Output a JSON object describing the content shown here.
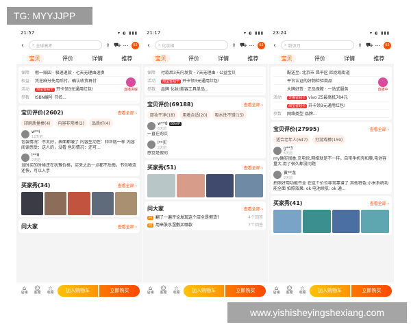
{
  "tg_label": "TG: MYYJJPP",
  "watermark": "www.yishisheyingshexiang.com",
  "icons": {
    "back": "back-icon",
    "share": "share-icon",
    "cart": "cart-icon",
    "more": "more-icon",
    "shop": "shop-icon",
    "service": "service-icon",
    "fav": "star-icon",
    "search": "search-icon"
  },
  "common": {
    "tabs": [
      "宝贝",
      "评价",
      "详情",
      "推荐"
    ],
    "badge": "65",
    "bottom": {
      "shop": "店铺",
      "service": "客服",
      "fav": "收藏",
      "cart": "加入购物车",
      "buy": "立即购买"
    },
    "more": "查看全部"
  },
  "screens": [
    {
      "time": "21:57",
      "status_right": "▾ ◐ ▮▮▮",
      "search": "全球高考",
      "params": [
        {
          "k": "保障",
          "v": "假一赔四 · 极速退款 · 七天无理由退换"
        },
        {
          "k": "权益",
          "v": "凭芝麻分先用后付，确认收货再付"
        },
        {
          "k": "活动",
          "tag": "淘宝省钱卡",
          "v": "开卡领3元通用红包!"
        },
        {
          "k": "参数",
          "v": "ISBN编号 书名..."
        }
      ],
      "live": "直播讲解",
      "review_title": "宝贝评价(2602)",
      "chips": [
        "印刷质量棒(4)",
        "内容非常棒(2)",
        "品质好(4)"
      ],
      "reviews": [
        {
          "user": "w**i",
          "date": "12天前",
          "text": "包装情况：不太好，表面都皱了 内容生动性：和正版一样 内容阅读感受：送人的，没看 色彩情况：还可…"
        },
        {
          "user": "l**8",
          "date": "2天前",
          "text": "当时买的时候还在犹豫价格，买来之后一点都不后悔，书包物流还快，可以入手"
        }
      ],
      "show_title": "买家秀(34)",
      "photos": [
        "#3b3b46",
        "#8b6d5a",
        "#c2543f",
        "#5f6a7a",
        "#a89070"
      ],
      "qa_title": "问大家"
    },
    {
      "time": "21:17",
      "status_right": "▾ ◐ ▮▮▮",
      "search": "化妆棉",
      "params": [
        {
          "k": "保障",
          "v": "付款后3天内发货 · 7天无理由 · 公益宝贝"
        },
        {
          "k": "活动",
          "tag": "淘宝省钱卡",
          "v": "开卡领3元通用红包!"
        },
        {
          "k": "参数",
          "v": "品牌 化妆/美容工具单品..."
        }
      ],
      "review_title": "宝贝评价(69188)",
      "chips": [
        "卸妆干净(18)",
        "用着合适(20)",
        "吸水性不错(15)"
      ],
      "reviews": [
        {
          "user": "w**8",
          "vip": "88VIP",
          "date": "6天前",
          "text": "一直在购买"
        },
        {
          "user": "l**实",
          "date": "2天前",
          "text": "感觉是假的"
        }
      ],
      "show_title": "买家秀(51)",
      "photos": [
        "#b9c6c8",
        "#d89c8a",
        "#3f4a6c",
        "#6e8aa5"
      ],
      "qa_title": "问大家",
      "qa": [
        {
          "q": "翻了一遍评论发现这个店全是假货?",
          "n": "4个回答"
        },
        {
          "q": "用来肤水湿敷买哪款",
          "n": "7个回答"
        }
      ]
    },
    {
      "time": "23:24",
      "status_right": "▾ ◐ ▮▮▮",
      "search": "剃须刀",
      "params": [
        {
          "k": "",
          "v": "配送至: 北京市 昌平区 回龙观街道"
        },
        {
          "k": "",
          "v": "平台认证的好物检验商品"
        },
        {
          "k": "",
          "v": "大牌好货 · 正品保障 · 一站式服务"
        },
        {
          "k": "活动",
          "tag": "天猫省钱卡",
          "v": "vivo Z5最高抵784元"
        },
        {
          "k": "",
          "tag": "淘宝省钱卡",
          "v": "开卡领3元通用红包!"
        },
        {
          "k": "参数",
          "v": "网络类型 品牌..."
        }
      ],
      "live": "直播中",
      "review_title": "宝贝评价(27995)",
      "chips": [
        "适合老年人(647)",
        "打游戏棒(159)"
      ],
      "reviews": [
        {
          "user": "g**3",
          "date": "6天前",
          "text": "my确实很香,充电快,网络就是不一样。自带手机壳和膜,电池容量大,用了很久都没问题"
        },
        {
          "user": "黄**龙",
          "date": "2天前",
          "text": "拍照好用功能齐全 在这个价位非常靠谱了 其他特色:小米系统功能全面 拍照效果: ok 电池续航: ok 通…"
        }
      ],
      "show_title": "买家秀(41)",
      "photos": [
        "#7aa3c8",
        "#3c8f8f",
        "#4a6fa0",
        "#5fa7b0"
      ]
    }
  ]
}
